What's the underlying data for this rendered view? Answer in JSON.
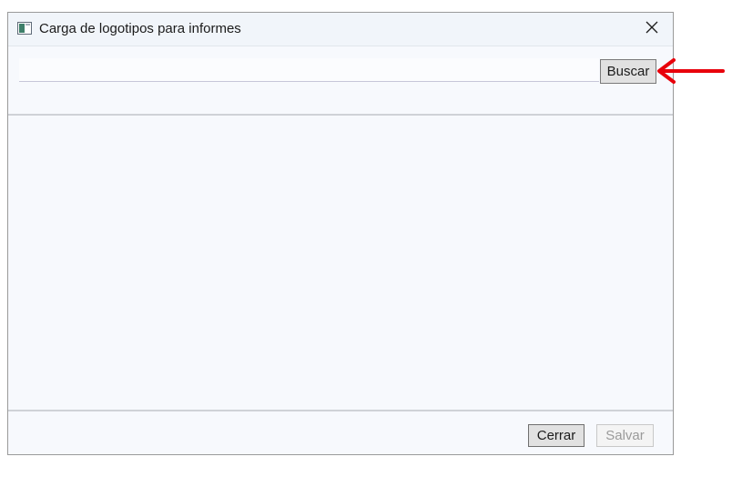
{
  "window": {
    "title": "Carga de logotipos para informes",
    "icon": "window-app-icon",
    "close_icon": "close-icon"
  },
  "toolbar": {
    "path_value": "",
    "path_placeholder": "",
    "search_label": "Buscar"
  },
  "footer": {
    "close_label": "Cerrar",
    "save_label": "Salvar"
  },
  "colors": {
    "annotation": "#e8000b",
    "dialog_bg": "#f7f9fd",
    "titlebar_bg": "#f1f5fa"
  }
}
